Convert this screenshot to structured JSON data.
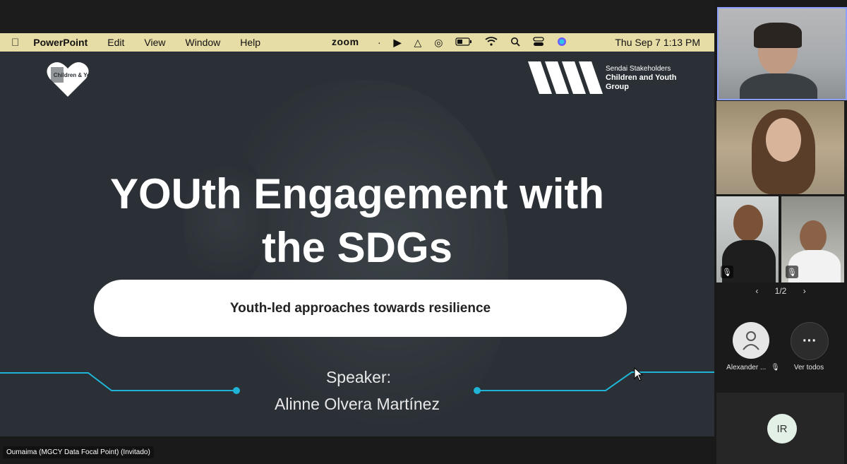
{
  "mac_menu": {
    "app": "PowerPoint",
    "items": [
      "Edit",
      "View",
      "Window",
      "Help"
    ],
    "zoom_label": "zoom",
    "clock": "Thu Sep 7  1:13 PM"
  },
  "slide": {
    "title_line1": "YOUth Engagement with",
    "title_line2": "the SDGs",
    "subtitle": "Youth-led approaches towards resilience",
    "speaker_label": "Speaker:",
    "speaker_name": "Alinne Olvera Martínez",
    "logo_left_text": "Children & Youth",
    "logo_right": {
      "line1": "Sendai Stakeholders",
      "line2": "Children and Youth",
      "line3": "Group"
    }
  },
  "presenter_caption": "Oumaima (MGCY Data Focal Point) (Invitado)",
  "participants": {
    "pager": "1/2",
    "alexander_label": "Alexander ...",
    "ver_todos_label": "Ver todos",
    "ir_initials": "IR"
  },
  "colors": {
    "mac_menubar": "#e6dca6",
    "slide_bg": "#2a3035",
    "accent_cyan": "#1fb4d6",
    "active_speaker_border": "#8ea0ff"
  }
}
